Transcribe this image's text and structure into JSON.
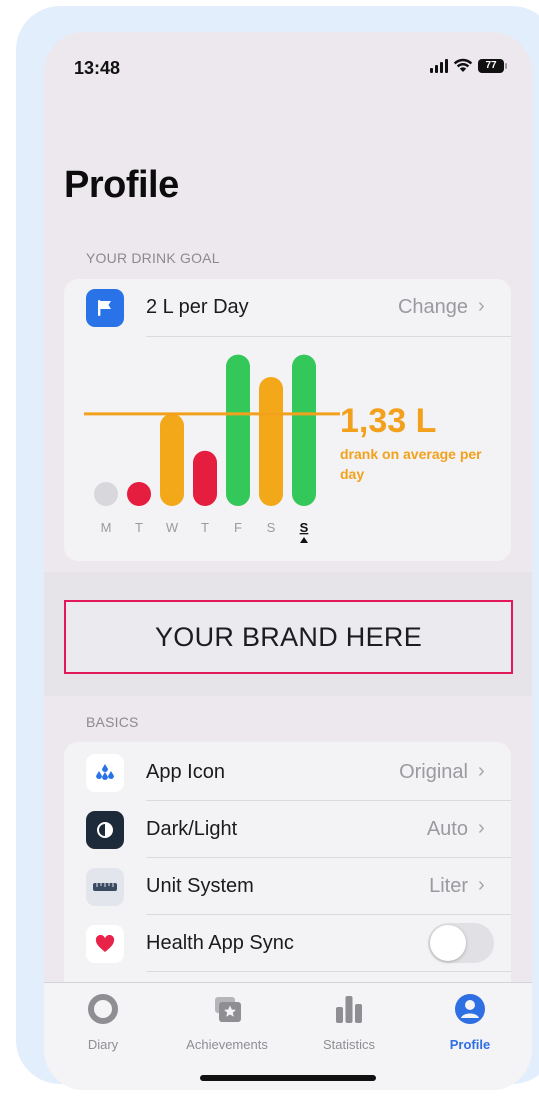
{
  "status_bar": {
    "time": "13:48",
    "battery": "77"
  },
  "page": {
    "title": "Profile"
  },
  "drink_goal": {
    "section_label": "YOUR DRINK GOAL",
    "goal_label": "2 L per Day",
    "change_label": "Change",
    "average_value": "1,33 L",
    "average_caption": "drank on average per day"
  },
  "chart_data": {
    "type": "bar",
    "categories": [
      "M",
      "T",
      "W",
      "T",
      "F",
      "S",
      "S"
    ],
    "values": [
      0.05,
      0.15,
      0.7,
      0.42,
      1.15,
      0.98,
      1.15
    ],
    "goal": 0.7,
    "current_index": 6,
    "colors": [
      "#d8d8dc",
      "#e51d3e",
      "#f2a818",
      "#e51d3e",
      "#34c759",
      "#f2a818",
      "#34c759"
    ],
    "goal_line_color": "#f3a11c",
    "ylim": [
      0,
      1.2
    ]
  },
  "brand": {
    "text": "YOUR BRAND HERE",
    "border_color": "#e3185a"
  },
  "basics": {
    "section_label": "BASICS",
    "items": [
      {
        "label": "App Icon",
        "value": "Original",
        "icon": "drops-icon"
      },
      {
        "label": "Dark/Light",
        "value": "Auto",
        "icon": "contrast-icon"
      },
      {
        "label": "Unit System",
        "value": "Liter",
        "icon": "ruler-icon"
      },
      {
        "label": "Health App Sync",
        "value": "",
        "icon": "heart-icon",
        "toggle": false
      }
    ]
  },
  "tabs": [
    {
      "label": "Diary",
      "icon": "ring-icon",
      "active": false
    },
    {
      "label": "Achievements",
      "icon": "star-cards-icon",
      "active": false
    },
    {
      "label": "Statistics",
      "icon": "bar-chart-icon",
      "active": false
    },
    {
      "label": "Profile",
      "icon": "person-icon",
      "active": true
    }
  ],
  "colors": {
    "accent": "#2f6fe4",
    "goal": "#f3a11c",
    "brand_border": "#e3185a"
  }
}
